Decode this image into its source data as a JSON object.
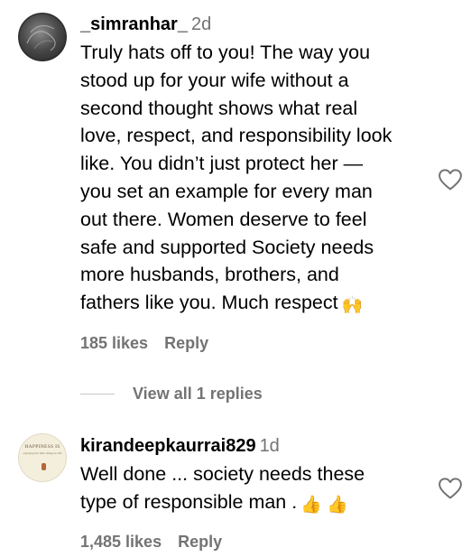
{
  "comments": [
    {
      "username": "_simranhar_",
      "time": "2d",
      "lines": [
        "Truly hats off to you! The way you",
        "stood up for your wife without a",
        "second thought shows what real",
        "love, respect, and responsibility look",
        "like. You didn’t just protect her —",
        "you set an example for every man",
        "out there. Women deserve to feel",
        "safe and supported Society needs",
        "more husbands, brothers, and",
        "fathers like you. Much respect"
      ],
      "emoji": "🙌",
      "likes": "185 likes",
      "reply": "Reply",
      "view_replies": "View all 1 replies"
    },
    {
      "username": "kirandeepkaurrai829",
      "time": "1d",
      "avatar_text": "HAPPINESS IS",
      "avatar_subtext": "enjoying the little things in life",
      "lines": [
        "Well done ... society needs these",
        "type of responsible man ."
      ],
      "emoji": "👍 👍",
      "likes": "1,485 likes",
      "reply": "Reply"
    }
  ],
  "icons": {
    "like": "heart-outline-icon"
  },
  "colors": {
    "secondary_text": "#737373",
    "divider": "#c7c7c7"
  }
}
